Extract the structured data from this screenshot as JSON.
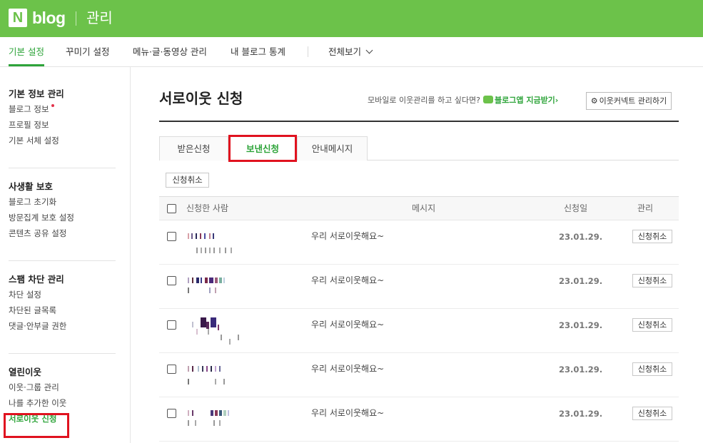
{
  "header": {
    "logo_mark": "N",
    "logo_text": "blog",
    "title": "관리"
  },
  "topnav": {
    "tabs": [
      "기본 설정",
      "꾸미기 설정",
      "메뉴·글·동영상 관리",
      "내 블로그 통계"
    ],
    "more_label": "전체보기",
    "accent": "#2ea43a"
  },
  "sidebar": {
    "sections": [
      {
        "title": "기본 정보 관리",
        "items": [
          "블로그 정보",
          "프로필 정보",
          "기본 서체 설정"
        ]
      },
      {
        "title": "사생활 보호",
        "items": [
          "블로그 초기화",
          "방문집계 보호 설정",
          "콘텐츠 공유 설정"
        ]
      },
      {
        "title": "스팸 차단 관리",
        "items": [
          "차단 설정",
          "차단된 글목록",
          "댓글·안부글 권한"
        ]
      },
      {
        "title": "열린이웃",
        "items": [
          "이웃·그룹 관리",
          "나를 추가한 이웃",
          "서로이웃 신청"
        ]
      }
    ]
  },
  "main": {
    "title": "서로이웃 신청",
    "promo_text": "모바일로 이웃관리를 하고 싶다면?",
    "promo_link": "블로그앱 지금받기›",
    "connect_button": "이웃커넥트 관리하기",
    "subtabs": [
      "받은신청",
      "보낸신청",
      "안내메시지"
    ],
    "cancel_top_button": "신청취소",
    "table": {
      "headers": {
        "person": "신청한 사람",
        "message": "메시지",
        "date": "신청일",
        "manage": "관리"
      },
      "rows": [
        {
          "message": "우리 서로이웃해요~",
          "date": "23.01.29.",
          "action": "신청취소"
        },
        {
          "message": "우리 서로이웃해요~",
          "date": "23.01.29.",
          "action": "신청취소"
        },
        {
          "message": "우리 서로이웃해요~",
          "date": "23.01.29.",
          "action": "신청취소"
        },
        {
          "message": "우리 서로이웃해요~",
          "date": "23.01.29.",
          "action": "신청취소"
        },
        {
          "message": "우리 서로이웃해요~",
          "date": "23.01.29.",
          "action": "신청취소"
        }
      ]
    }
  },
  "colors": {
    "brand": "#6cc24a",
    "accent": "#2ea43a",
    "highlight": "#e0121f"
  }
}
